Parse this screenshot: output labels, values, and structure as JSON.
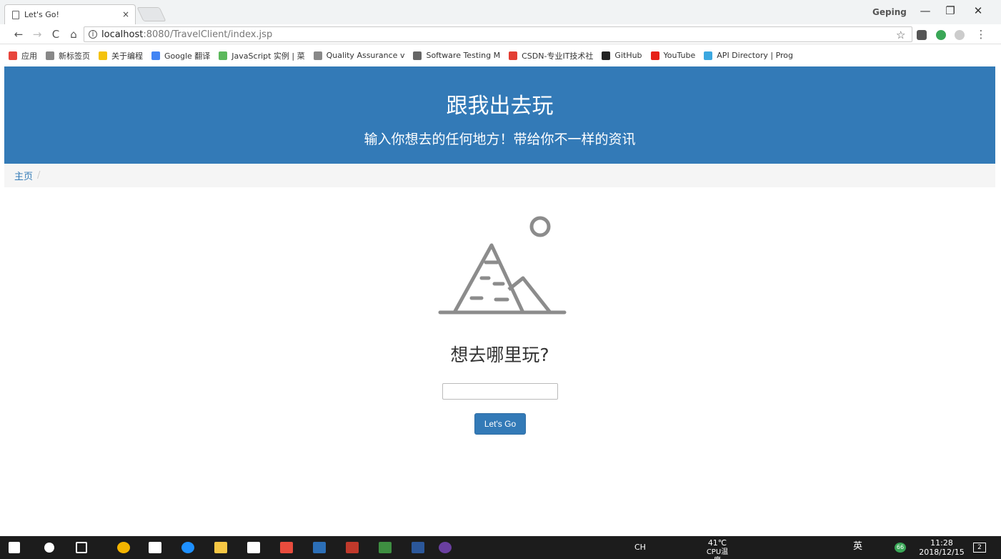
{
  "browser": {
    "tab_title": "Let's Go!",
    "tab_close": "×",
    "profile_name": "Geping",
    "window_controls": [
      "—",
      "❐",
      "✕"
    ],
    "nav_icons": [
      "←",
      "→",
      "C",
      "⌂"
    ],
    "url_host": "localhost",
    "url_path": ":8080/TravelClient/index.jsp",
    "star": "☆",
    "menu": "⋮"
  },
  "bookmarks": [
    {
      "label": "应用",
      "color": "#e8453c"
    },
    {
      "label": "新标签页",
      "color": "#888888"
    },
    {
      "label": "关于编程",
      "color": "#f4c20d"
    },
    {
      "label": "Google 翻译",
      "color": "#4285f4"
    },
    {
      "label": "JavaScript 实例 | 菜",
      "color": "#5cb85c"
    },
    {
      "label": "Quality Assurance v",
      "color": "#888888"
    },
    {
      "label": "Software Testing M",
      "color": "#666666"
    },
    {
      "label": "CSDN-专业IT技术社",
      "color": "#e33e33"
    },
    {
      "label": "GitHub",
      "color": "#222222"
    },
    {
      "label": "YouTube",
      "color": "#e62117"
    },
    {
      "label": "API Directory | Prog",
      "color": "#3ba7e0"
    }
  ],
  "header": {
    "title": "跟我出去玩",
    "subtitle": "输入你想去的任何地方！带给你不一样的资讯"
  },
  "breadcrumb": {
    "home": "主页",
    "separator": "/"
  },
  "main": {
    "question": "想去哪里玩?",
    "input_value": "",
    "button_label": "Let's Go"
  },
  "taskbar": {
    "ime": "CH",
    "temperature": "41℃",
    "temp_label": "CPU温度",
    "lang": "英",
    "badge": "66",
    "time": "11:28",
    "date": "2018/12/15",
    "notifications": "2"
  },
  "colors": {
    "primary": "#337ab7",
    "breadcrumb_bg": "#f5f5f5",
    "icon_gray": "#8c8c8c"
  }
}
